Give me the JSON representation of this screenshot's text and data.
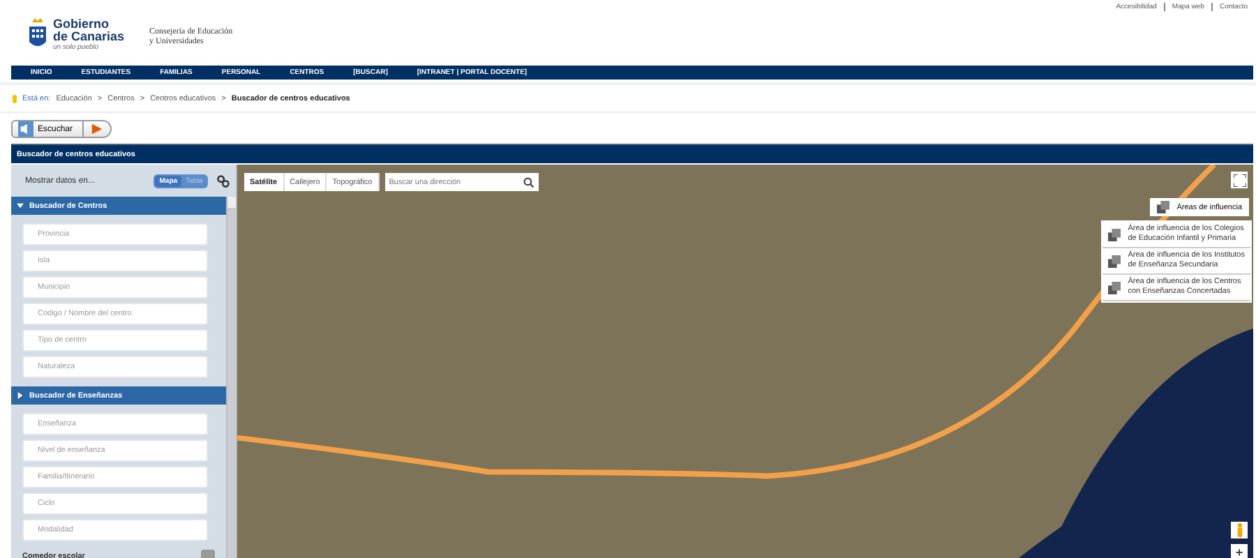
{
  "header": {
    "logo": {
      "name": "Gobierno",
      "name2": "de Canarias",
      "tagline": "un solo pueblo"
    },
    "department": [
      "Consejería de Educación",
      "y Universidades"
    ],
    "top_links": [
      "Accesibilidad",
      "Mapa web",
      "Contacto"
    ]
  },
  "nav": [
    "INICIO",
    "ESTUDIANTES",
    "FAMILIAS",
    "PERSONAL",
    "CENTROS",
    "[BUSCAR]",
    "[INTRANET | PORTAL DOCENTE]"
  ],
  "breadcrumb": {
    "label": "Está en:",
    "separator": ">",
    "items": [
      "Educación",
      "Centros",
      "Centros educativos",
      "Buscador de centros educativos"
    ]
  },
  "listen": {
    "label": "Escuchar"
  },
  "section_title": "Buscador de centros educativos",
  "sidebar": {
    "show_label": "Mostrar datos en...",
    "views": [
      {
        "label": "Mapa",
        "selected": true
      },
      {
        "label": "Tabla",
        "selected": false
      }
    ],
    "groups": [
      {
        "title": "Buscador de Centros",
        "expanded": true,
        "fields": [
          {
            "placeholder": "Provincia"
          },
          {
            "placeholder": "Isla"
          },
          {
            "placeholder": "Municipio"
          },
          {
            "placeholder": "Código / Nombre del centro"
          },
          {
            "placeholder": "Tipo de centro"
          },
          {
            "placeholder": "Naturaleza"
          }
        ]
      },
      {
        "title": "Buscador de Enseñanzas",
        "expanded": false,
        "fields": [
          {
            "placeholder": "Enseñanza"
          },
          {
            "placeholder": "Nivel de enseñanza"
          },
          {
            "placeholder": "Familia/Itinerario"
          },
          {
            "placeholder": "Ciclo"
          },
          {
            "placeholder": "Modalidad"
          }
        ]
      }
    ],
    "checkbox": {
      "label": "Comedor escolar",
      "checked": false
    }
  },
  "map": {
    "tabs": [
      {
        "label": "Satélite",
        "selected": true
      },
      {
        "label": "Callejero",
        "selected": false
      },
      {
        "label": "Topográfico",
        "selected": false
      }
    ],
    "search": {
      "placeholder": "Buscar una dirección"
    },
    "areas_button": "Áreas de influencia",
    "areas": [
      [
        "Área de influencia de los Colegios",
        "de Educación Infantil y Primaria"
      ],
      [
        "Área de influencia de los Institutos",
        "de Enseñanza Secundaria"
      ],
      [
        "Área de influencia de los Centros",
        "con Enseñanzas Concertadas"
      ]
    ],
    "zoom_in": "+"
  }
}
